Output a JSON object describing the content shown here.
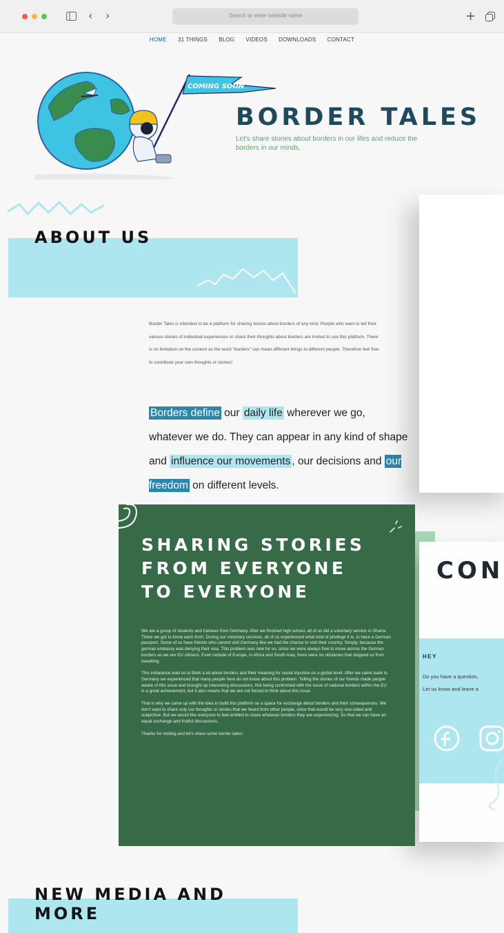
{
  "browser": {
    "address_placeholder": "Search or enter website name",
    "colors": {
      "close": "#ec5c53",
      "minimize": "#f2bd3c",
      "maximize": "#5ec44c"
    }
  },
  "nav": {
    "items": [
      {
        "label": "HOME"
      },
      {
        "label": "31 THINGS"
      },
      {
        "label": "BLOG"
      },
      {
        "label": "VIDEOS"
      },
      {
        "label": "DOWNLOADS"
      },
      {
        "label": "CONTACT"
      }
    ]
  },
  "hero": {
    "flag_text": "COMING SOON",
    "title": "BORDER TALES",
    "tagline": "Let's share stories about borders in our lifes and reduce the borders in our minds."
  },
  "about": {
    "heading": "ABOUT US",
    "body": "Border Tales is intended to be a platform for sharing stories about borders of any kind. People who want to tell their various stories of individual experiences or share their thoughts about borders are invited to use this platform. There is no limitation on the content as the word \"borders\" can mean different things to different people. Therefore feel free to contribute your own thoughts or stories!",
    "quote": {
      "p1": "Borders define",
      "p2": " our ",
      "p3": "daily life",
      "p4": " wherever we go, whatever we do. They can appear in any kind of shape and ",
      "p5": "influence our movements",
      "p6": ", our decisions and ",
      "p7": "our freedom",
      "p8": " on different levels."
    }
  },
  "stories": {
    "heading_line1": "SHARING STORIES",
    "heading_line2": "FROM EVERYONE",
    "heading_line3": "TO EVERYONE",
    "paragraphs": [
      "We are a group of students and trainees from Germany. After we finished high school, all of us did a voluntary service in Ghana. There we got to know each from. During our voluntary services, all of us experienced what kind of privilege it is, to have a German passport. Some of us have friends who cannot visit Germany like we had the chance to visit their country. Simply, because the german embassy was denying their visa. This problem was new for us, since we were always free to move across the German borders as we are EU citizens. Even outside of Europe, in Africa and South Asia, there were no obstacles that stopped us from travelling.",
      "This imbalance lead us to think a lot about borders and their meaning for social injustice on a global level. After we came back to Germany we experienced that many people here do not know about this problem. Telling the stories of our friends made people aware of this issue and brought up interesting discussions. Not being confronted with the issue of national borders within the EU is a great achievement, but it also means that we are not forced to think about this issue.",
      "That is why we came up with the idea to build this platform as a space for exchange about borders and their consequences. We don't want to share only our thoughts or stories that we heard from other people, since that would be very one-sided and subjective. But we would like everyone to feel entitled to share whatever borders they are experiencing. So that we can have an equal exchange and fruitful discussions.",
      "Thanks for visiting and let's share some border tales!"
    ]
  },
  "contact": {
    "title": "CON",
    "hey": "HEY",
    "line1": "Do you have a question,",
    "line2": "Let us know and leave a",
    "social": [
      "facebook-icon",
      "instagram-icon"
    ]
  },
  "media": {
    "heading": "NEW MEDIA AND MORE"
  },
  "colors": {
    "accent_blue": "#aee6ef",
    "highlight_dark": "#2b86ad",
    "forest_green": "#376b48",
    "title_teal": "#1e4a5c",
    "tagline_green": "#5aa36a"
  }
}
